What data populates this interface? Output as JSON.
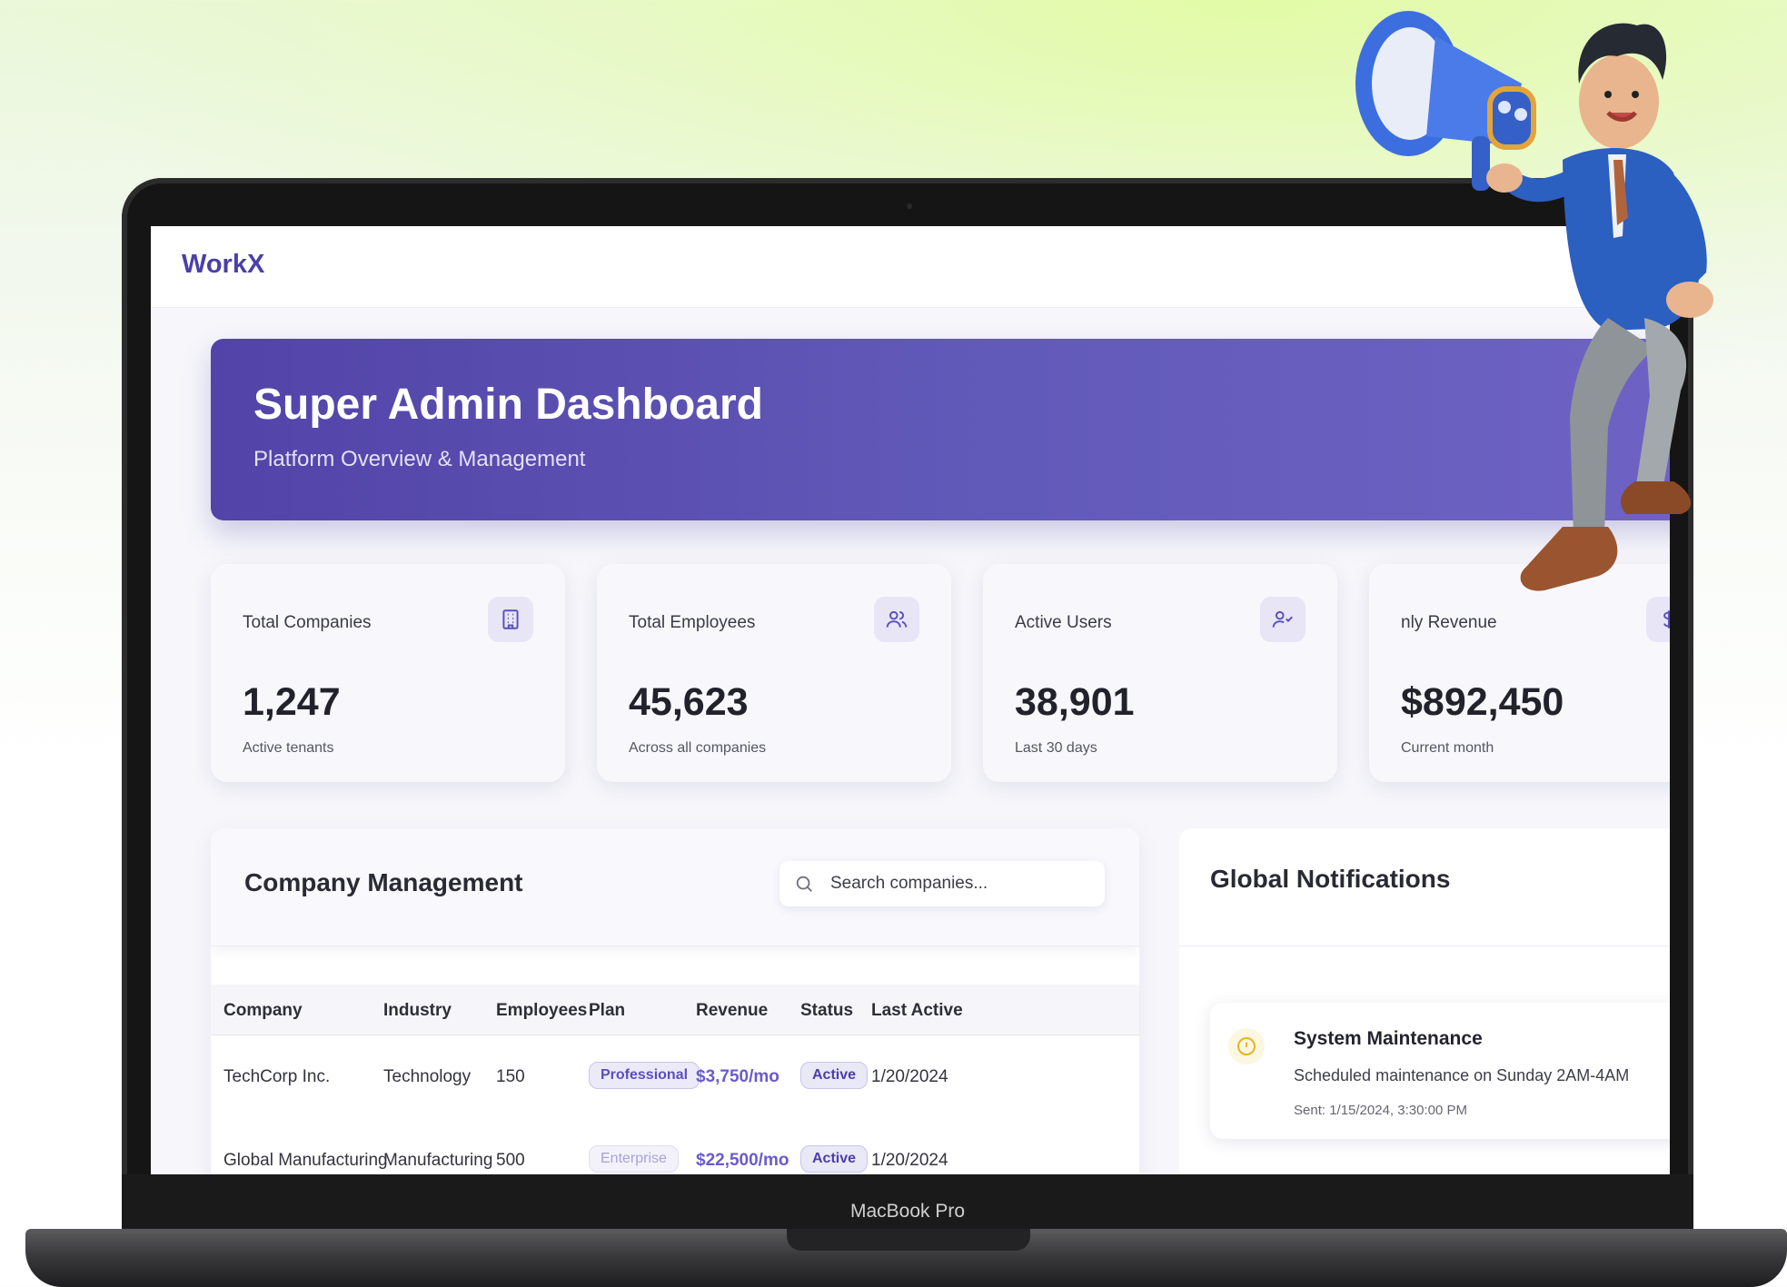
{
  "app": {
    "brand": "WorkX"
  },
  "hero": {
    "title": "Super Admin Dashboard",
    "subtitle": "Platform Overview & Management"
  },
  "stats": [
    {
      "label": "Total Companies",
      "value": "1,247",
      "note": "Active tenants",
      "icon": "building-icon"
    },
    {
      "label": "Total Employees",
      "value": "45,623",
      "note": "Across all companies",
      "icon": "users-icon"
    },
    {
      "label": "Active Users",
      "value": "38,901",
      "note": "Last 30 days",
      "icon": "user-check-icon"
    },
    {
      "label": "nly Revenue",
      "value": "$892,450",
      "note": "Current month",
      "icon": "dollar-icon"
    }
  ],
  "company_management": {
    "title": "Company Management",
    "search_placeholder": "Search companies...",
    "columns": [
      "Company",
      "Industry",
      "Employees",
      "Plan",
      "Revenue",
      "Status",
      "Last Active"
    ],
    "rows": [
      {
        "company": "TechCorp Inc.",
        "industry": "Technology",
        "employees": "150",
        "plan": "Professional",
        "revenue": "$3,750/mo",
        "status": "Active",
        "last_active": "1/20/2024"
      },
      {
        "company": "Global Manufacturing",
        "industry": "Manufacturing",
        "employees": "500",
        "plan": "Enterprise",
        "revenue": "$22,500/mo",
        "status": "Active",
        "last_active": "1/20/2024"
      }
    ]
  },
  "notifications": {
    "title": "Global Notifications",
    "items": [
      {
        "title": "System Maintenance",
        "body": "Scheduled maintenance on Sunday 2AM-4AM",
        "sent": "Sent: 1/15/2024, 3:30:00 PM",
        "icon": "alert-circle-icon"
      }
    ]
  },
  "device": {
    "label": "MacBook Pro"
  },
  "colors": {
    "brand": "#4b3fa8",
    "hero_start": "#5243a8",
    "hero_end": "#6e63c4",
    "accent": "#6a5ad0",
    "background": "#eaf8d8"
  }
}
